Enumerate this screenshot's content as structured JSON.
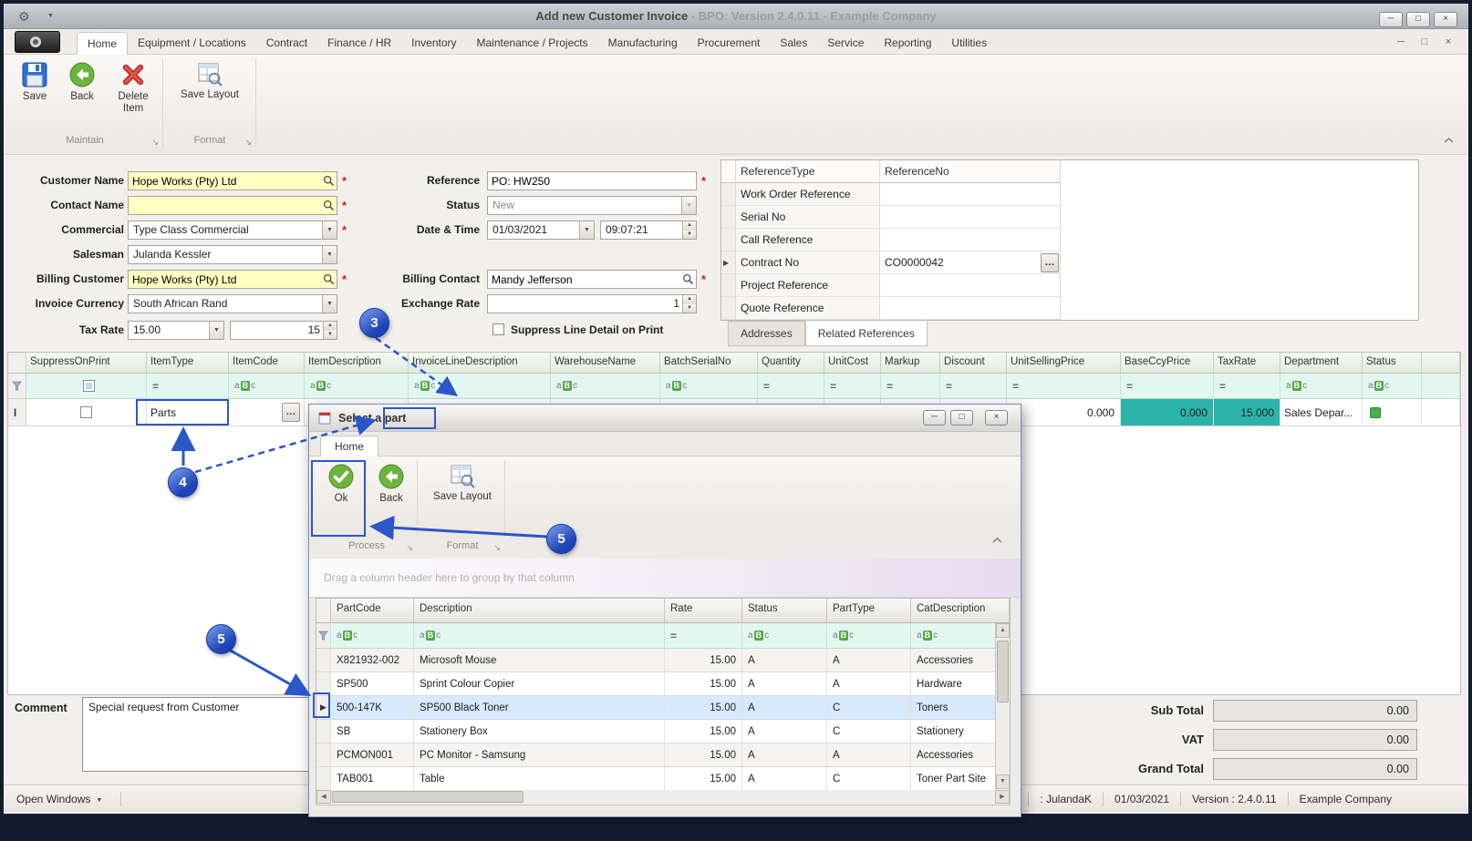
{
  "icons": {
    "app": "⚙",
    "titlebar_caret": "▼",
    "minimize": "─",
    "restore": "□",
    "close": "×",
    "dropdown": "▼",
    "spin_up": "▲",
    "spin_down": "▼",
    "ellipsis": "…",
    "required": "*",
    "row_arrow": "▶",
    "row_edit": "Ι",
    "equals": "=",
    "abc_a": "a",
    "abc_b": "B",
    "abc_c": "c",
    "launcher": "↘",
    "open_windows_caret": "▼",
    "scroll_left": "◀",
    "scroll_right": "▶",
    "scroll_up": "▲",
    "scroll_down": "▼"
  },
  "titlebar": {
    "title": "Add new Customer Invoice",
    "subtitle": " - BPO: Version 2.4.0.11 - Example Company"
  },
  "menubar": {
    "tabs": [
      {
        "label": "Home"
      },
      {
        "label": "Equipment / Locations"
      },
      {
        "label": "Contract"
      },
      {
        "label": "Finance / HR"
      },
      {
        "label": "Inventory"
      },
      {
        "label": "Maintenance / Projects"
      },
      {
        "label": "Manufacturing"
      },
      {
        "label": "Procurement"
      },
      {
        "label": "Sales"
      },
      {
        "label": "Service"
      },
      {
        "label": "Reporting"
      },
      {
        "label": "Utilities"
      }
    ]
  },
  "ribbon": {
    "save": "Save",
    "back": "Back",
    "delete_item": "Delete Item",
    "save_layout": "Save Layout",
    "group_maintain": "Maintain",
    "group_format": "Format"
  },
  "form": {
    "customer_name": {
      "label": "Customer Name",
      "value": "Hope Works (Pty) Ltd"
    },
    "contact_name": {
      "label": "Contact Name",
      "value": ""
    },
    "commercial": {
      "label": "Commercial",
      "value": "Type Class Commercial"
    },
    "salesman": {
      "label": "Salesman",
      "value": "Julanda Kessler"
    },
    "billing_customer": {
      "label": "Billing Customer",
      "value": "Hope Works (Pty) Ltd"
    },
    "invoice_currency": {
      "label": "Invoice Currency",
      "value": "South African Rand"
    },
    "tax_rate": {
      "label": "Tax Rate",
      "combo_value": "15.00",
      "spin_value": "15"
    },
    "reference": {
      "label": "Reference",
      "value": "PO: HW250"
    },
    "status": {
      "label": "Status",
      "value": "New"
    },
    "date_time": {
      "label": "Date & Time",
      "date": "01/03/2021",
      "time": "09:07:21"
    },
    "billing_contact": {
      "label": "Billing Contact",
      "value": "Mandy Jefferson"
    },
    "exchange_rate": {
      "label": "Exchange Rate",
      "value": "1"
    },
    "suppress_line_detail": {
      "label": "Suppress Line Detail on Print"
    }
  },
  "references": {
    "col_type": "ReferenceType",
    "col_no": "ReferenceNo",
    "rows": [
      {
        "type": "Work Order Reference",
        "no": ""
      },
      {
        "type": "Serial No",
        "no": ""
      },
      {
        "type": "Call Reference",
        "no": ""
      },
      {
        "type": "Contract No",
        "no": "CO0000042"
      },
      {
        "type": "Project Reference",
        "no": ""
      },
      {
        "type": "Quote Reference",
        "no": ""
      }
    ],
    "tab_addresses": "Addresses",
    "tab_related": "Related References"
  },
  "invoice_grid": {
    "columns": [
      "SuppressOnPrint",
      "ItemType",
      "ItemCode",
      "ItemDescription",
      "InvoiceLineDescription",
      "WarehouseName",
      "BatchSerialNo",
      "Quantity",
      "UnitCost",
      "Markup",
      "Discount",
      "UnitSellingPrice",
      "BaseCcyPrice",
      "TaxRate",
      "Department",
      "Status"
    ],
    "row": {
      "item_type": "Parts",
      "unit_selling_price": "0.000",
      "base_ccy_price": "0.000",
      "tax_rate": "15.000",
      "department": "Sales Depar..."
    }
  },
  "part_dialog": {
    "title_prefix": "Select a ",
    "title_word": "part",
    "tab_home": "Home",
    "ok": "Ok",
    "back": "Back",
    "save_layout": "Save Layout",
    "group_process": "Process",
    "group_format": "Format",
    "group_hint": "Drag a column header here to group by that column",
    "columns": [
      "PartCode",
      "Description",
      "Rate",
      "Status",
      "PartType",
      "CatDescription"
    ],
    "rows": [
      {
        "code": "X821932-002",
        "desc": "Microsoft Mouse",
        "rate": "15.00",
        "status": "A",
        "type": "A",
        "cat": "Accessories"
      },
      {
        "code": "SP500",
        "desc": "Sprint Colour Copier",
        "rate": "15.00",
        "status": "A",
        "type": "A",
        "cat": "Hardware"
      },
      {
        "code": "500-147K",
        "desc": "SP500 Black Toner",
        "rate": "15.00",
        "status": "A",
        "type": "C",
        "cat": "Toners"
      },
      {
        "code": "SB",
        "desc": "Stationery Box",
        "rate": "15.00",
        "status": "A",
        "type": "C",
        "cat": "Stationery"
      },
      {
        "code": "PCMON001",
        "desc": "PC Monitor - Samsung",
        "rate": "15.00",
        "status": "A",
        "type": "A",
        "cat": "Accessories"
      },
      {
        "code": "TAB001",
        "desc": "Table",
        "rate": "15.00",
        "status": "A",
        "type": "C",
        "cat": "Toner Part Site"
      }
    ]
  },
  "footer": {
    "comment_label": "Comment",
    "comment_text": "Special request from Customer",
    "sub_total_label": "Sub Total",
    "sub_total_value": "0.00",
    "vat_label": "VAT",
    "vat_value": "0.00",
    "grand_total_label": "Grand Total",
    "grand_total_value": "0.00"
  },
  "statusbar": {
    "open_windows": "Open Windows",
    "user": ": JulandaK",
    "date": "01/03/2021",
    "version": "Version : 2.4.0.11",
    "company": "Example Company"
  },
  "callouts": {
    "three": "3",
    "four": "4",
    "five": "5"
  }
}
